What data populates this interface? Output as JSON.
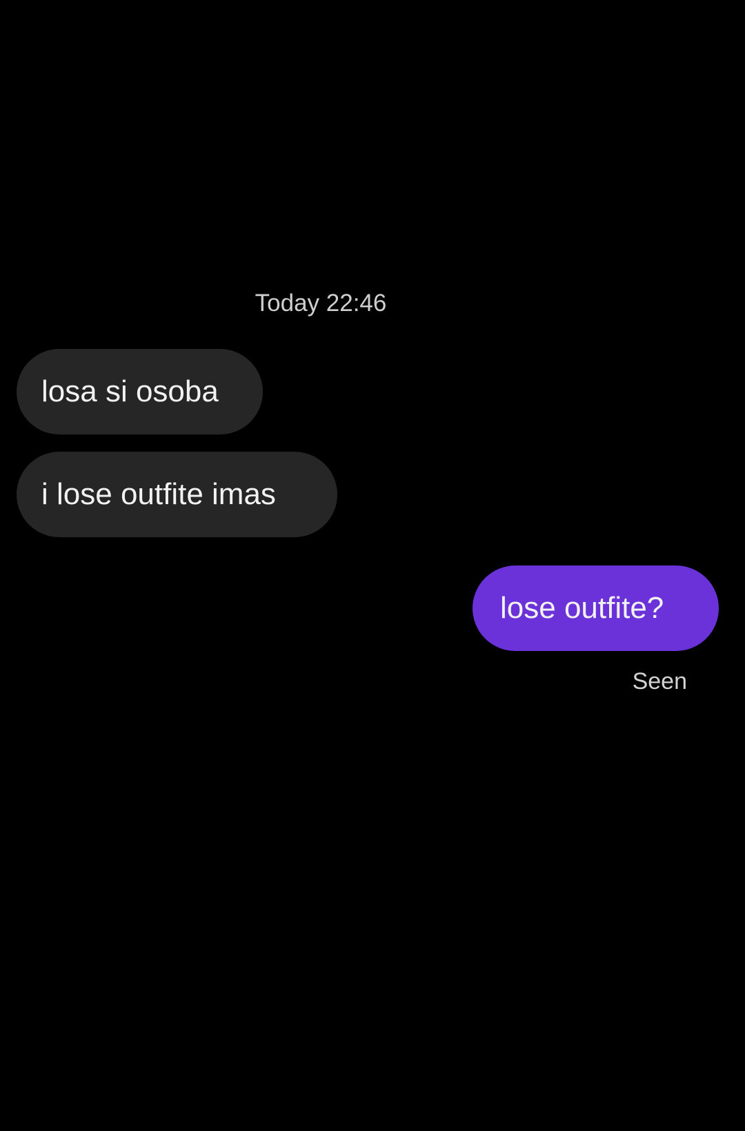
{
  "conversation": {
    "timestamp": "Today 22:46",
    "messages": [
      {
        "direction": "incoming",
        "text": "losa si osoba"
      },
      {
        "direction": "incoming",
        "text": "i lose outfite imas"
      },
      {
        "direction": "outgoing",
        "text": "lose outfite?"
      }
    ],
    "read_receipt": "Seen"
  },
  "colors": {
    "background": "#000000",
    "incoming_bubble": "#262626",
    "outgoing_bubble": "#6a32d8",
    "text": "#f2f2f2",
    "meta_text": "#cfcfcf"
  }
}
